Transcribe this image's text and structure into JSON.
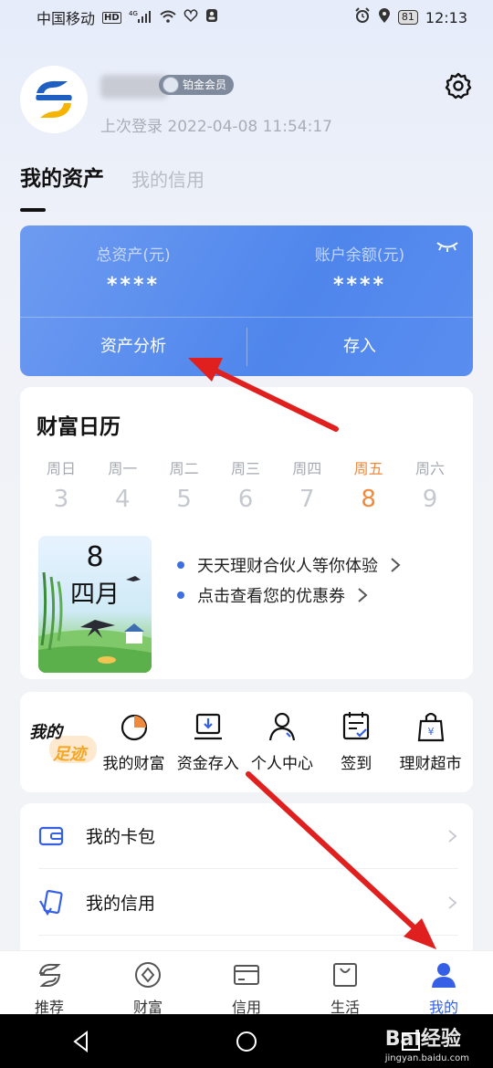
{
  "status_bar": {
    "carrier": "中国移动",
    "hd": "HD",
    "net": "4G",
    "battery": "81",
    "time": "12:13"
  },
  "profile": {
    "member_level": "铂金会员",
    "last_login": "上次登录 2022-04-08 11:54:17"
  },
  "tabs": {
    "assets": "我的资产",
    "credit": "我的信用"
  },
  "asset_card": {
    "total_assets_label": "总资产(元)",
    "total_assets_value": "****",
    "balance_label": "账户余额(元)",
    "balance_value": "****",
    "analysis_button": "资产分析",
    "deposit_button": "存入"
  },
  "calendar": {
    "title": "财富日历",
    "days": [
      {
        "weekday": "周日",
        "date": "3"
      },
      {
        "weekday": "周一",
        "date": "4"
      },
      {
        "weekday": "周二",
        "date": "5"
      },
      {
        "weekday": "周三",
        "date": "6"
      },
      {
        "weekday": "周四",
        "date": "7"
      },
      {
        "weekday": "周五",
        "date": "8"
      },
      {
        "weekday": "周六",
        "date": "9"
      }
    ],
    "today_index": 5,
    "picture_day": "8",
    "picture_month": "四月",
    "promos": [
      "天天理财合伙人等你体验",
      "点击查看您的优惠券"
    ]
  },
  "footprint": {
    "logo_line1": "我的",
    "logo_line2": "足迹",
    "items": [
      "我的财富",
      "资金存入",
      "个人中心",
      "签到",
      "理财超市"
    ]
  },
  "menu": {
    "card_wallet": "我的卡包",
    "my_credit": "我的信用"
  },
  "bottom_nav": [
    "推荐",
    "财富",
    "信用",
    "生活",
    "我的"
  ],
  "watermark": {
    "brand": "Bai经验",
    "url": "jingyan.baidu.com"
  },
  "colors": {
    "accent": "#3560e6",
    "card_blue": "#5b8ded",
    "today": "#ef8a3d",
    "arrow": "#e0201e"
  }
}
